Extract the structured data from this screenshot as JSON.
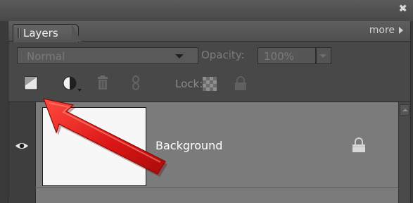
{
  "window": {
    "close_glyph": "✖"
  },
  "tabs": {
    "layers_label": "Layers"
  },
  "menu": {
    "more_label": "more"
  },
  "blend_mode": {
    "value": "Normal"
  },
  "opacity": {
    "label": "Opacity:",
    "value": "100%"
  },
  "toolbar": {
    "lock_label": "Lock:",
    "icons": [
      "new-layer-icon",
      "adjustment-layer-icon",
      "trash-icon",
      "link-icon",
      "lock-transparent-icon",
      "lock-all-icon"
    ]
  },
  "layers": [
    {
      "name": "Background",
      "visible": true,
      "locked": true
    }
  ],
  "annotation": {
    "arrow_color": "#e01b1b"
  }
}
